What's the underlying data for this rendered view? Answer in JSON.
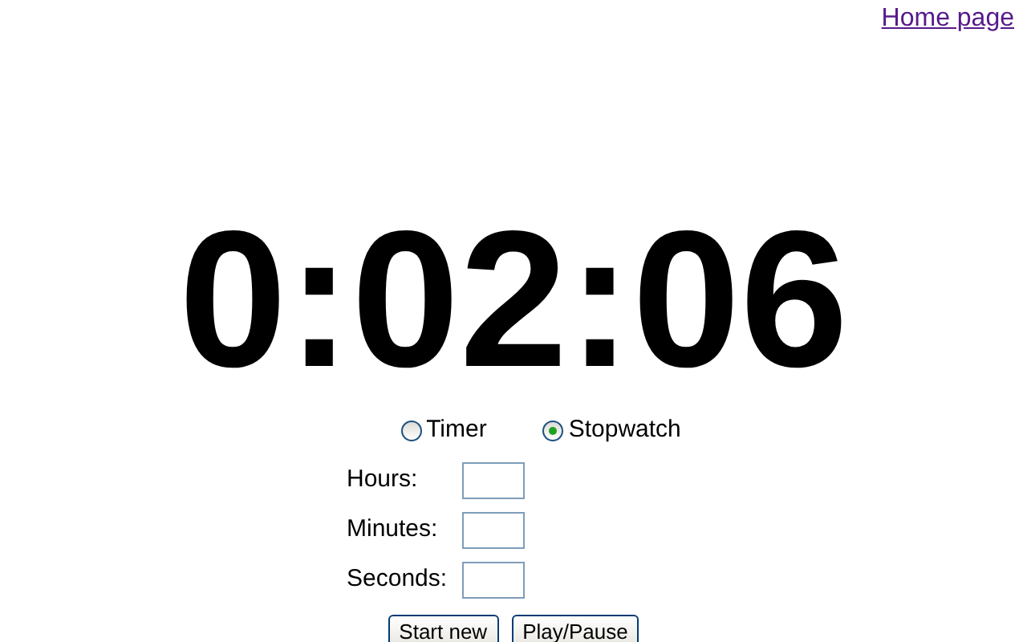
{
  "link": {
    "label": "Home page"
  },
  "clock": {
    "time": "0:02:06"
  },
  "modes": [
    {
      "label": "Timer",
      "selected": false
    },
    {
      "label": "Stopwatch",
      "selected": true
    }
  ],
  "fields": [
    {
      "label": "Hours:"
    },
    {
      "label": "Minutes:"
    },
    {
      "label": "Seconds:"
    }
  ],
  "buttons": [
    "Start new",
    "Play/Pause"
  ]
}
